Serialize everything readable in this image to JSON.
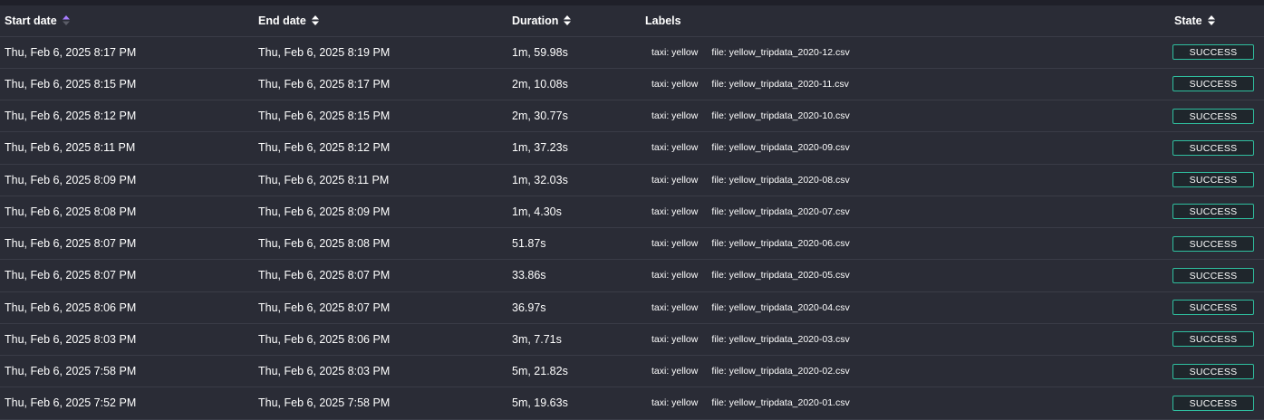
{
  "columns": {
    "start_date": "Start date",
    "end_date": "End date",
    "duration": "Duration",
    "labels": "Labels",
    "state": "State"
  },
  "colors": {
    "background": "#2a2c36",
    "success_border": "#2fbf9f",
    "sort_active": "#a77dff"
  },
  "rows": [
    {
      "start": "Thu, Feb 6, 2025 8:17 PM",
      "end": "Thu, Feb 6, 2025 8:19 PM",
      "duration": "1m, 59.98s",
      "labels": [
        "taxi: yellow",
        "file: yellow_tripdata_2020-12.csv"
      ],
      "state": "SUCCESS"
    },
    {
      "start": "Thu, Feb 6, 2025 8:15 PM",
      "end": "Thu, Feb 6, 2025 8:17 PM",
      "duration": "2m, 10.08s",
      "labels": [
        "taxi: yellow",
        "file: yellow_tripdata_2020-11.csv"
      ],
      "state": "SUCCESS"
    },
    {
      "start": "Thu, Feb 6, 2025 8:12 PM",
      "end": "Thu, Feb 6, 2025 8:15 PM",
      "duration": "2m, 30.77s",
      "labels": [
        "taxi: yellow",
        "file: yellow_tripdata_2020-10.csv"
      ],
      "state": "SUCCESS"
    },
    {
      "start": "Thu, Feb 6, 2025 8:11 PM",
      "end": "Thu, Feb 6, 2025 8:12 PM",
      "duration": "1m, 37.23s",
      "labels": [
        "taxi: yellow",
        "file: yellow_tripdata_2020-09.csv"
      ],
      "state": "SUCCESS"
    },
    {
      "start": "Thu, Feb 6, 2025 8:09 PM",
      "end": "Thu, Feb 6, 2025 8:11 PM",
      "duration": "1m, 32.03s",
      "labels": [
        "taxi: yellow",
        "file: yellow_tripdata_2020-08.csv"
      ],
      "state": "SUCCESS"
    },
    {
      "start": "Thu, Feb 6, 2025 8:08 PM",
      "end": "Thu, Feb 6, 2025 8:09 PM",
      "duration": "1m, 4.30s",
      "labels": [
        "taxi: yellow",
        "file: yellow_tripdata_2020-07.csv"
      ],
      "state": "SUCCESS"
    },
    {
      "start": "Thu, Feb 6, 2025 8:07 PM",
      "end": "Thu, Feb 6, 2025 8:08 PM",
      "duration": "51.87s",
      "labels": [
        "taxi: yellow",
        "file: yellow_tripdata_2020-06.csv"
      ],
      "state": "SUCCESS"
    },
    {
      "start": "Thu, Feb 6, 2025 8:07 PM",
      "end": "Thu, Feb 6, 2025 8:07 PM",
      "duration": "33.86s",
      "labels": [
        "taxi: yellow",
        "file: yellow_tripdata_2020-05.csv"
      ],
      "state": "SUCCESS"
    },
    {
      "start": "Thu, Feb 6, 2025 8:06 PM",
      "end": "Thu, Feb 6, 2025 8:07 PM",
      "duration": "36.97s",
      "labels": [
        "taxi: yellow",
        "file: yellow_tripdata_2020-04.csv"
      ],
      "state": "SUCCESS"
    },
    {
      "start": "Thu, Feb 6, 2025 8:03 PM",
      "end": "Thu, Feb 6, 2025 8:06 PM",
      "duration": "3m, 7.71s",
      "labels": [
        "taxi: yellow",
        "file: yellow_tripdata_2020-03.csv"
      ],
      "state": "SUCCESS"
    },
    {
      "start": "Thu, Feb 6, 2025 7:58 PM",
      "end": "Thu, Feb 6, 2025 8:03 PM",
      "duration": "5m, 21.82s",
      "labels": [
        "taxi: yellow",
        "file: yellow_tripdata_2020-02.csv"
      ],
      "state": "SUCCESS"
    },
    {
      "start": "Thu, Feb 6, 2025 7:52 PM",
      "end": "Thu, Feb 6, 2025 7:58 PM",
      "duration": "5m, 19.63s",
      "labels": [
        "taxi: yellow",
        "file: yellow_tripdata_2020-01.csv"
      ],
      "state": "SUCCESS"
    }
  ]
}
